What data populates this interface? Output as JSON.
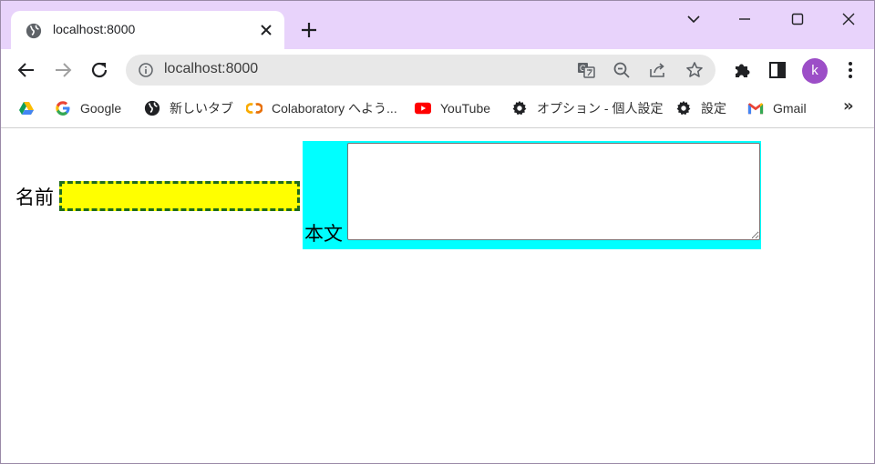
{
  "browser": {
    "tab": {
      "title": "localhost:8000"
    },
    "address_bar": {
      "url": "localhost:8000"
    },
    "profile": {
      "initial": "k",
      "color": "#9c4ec7"
    },
    "bookmarks": [
      {
        "label": "",
        "icon": "google-drive-icon"
      },
      {
        "label": "Google",
        "icon": "google-icon"
      },
      {
        "label": "新しいタブ",
        "icon": "globe-icon"
      },
      {
        "label": "Colaboratory へよう...",
        "icon": "colab-icon"
      },
      {
        "label": "YouTube",
        "icon": "youtube-icon"
      },
      {
        "label": "オプション - 個人設定",
        "icon": "gear-icon"
      },
      {
        "label": "設定",
        "icon": "gear-icon"
      },
      {
        "label": "Gmail",
        "icon": "gmail-icon"
      }
    ],
    "more_bookmarks": "»"
  },
  "page": {
    "name_label": "名前",
    "name_input": {
      "value": "",
      "background": "#ffff00",
      "border_color": "#1e6b1e"
    },
    "body_label": "本文",
    "body_textarea": {
      "value": ""
    },
    "body_container_color": "#00ffff"
  }
}
